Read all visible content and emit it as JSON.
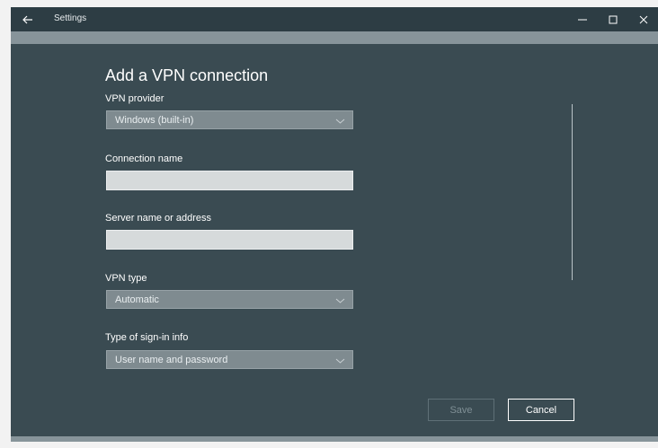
{
  "window": {
    "title": "Settings",
    "icons": {
      "back": "back-arrow-icon",
      "minimize": "minimize-icon",
      "maximize": "maximize-icon",
      "close": "close-icon"
    }
  },
  "page": {
    "heading": "Add a VPN connection"
  },
  "form": {
    "vpn_provider": {
      "label": "VPN provider",
      "value": "Windows (built-in)"
    },
    "connection_name": {
      "label": "Connection name",
      "value": ""
    },
    "server_address": {
      "label": "Server name or address",
      "value": ""
    },
    "vpn_type": {
      "label": "VPN type",
      "value": "Automatic"
    },
    "sign_in_type": {
      "label": "Type of sign-in info",
      "value": "User name and password"
    }
  },
  "actions": {
    "save": "Save",
    "cancel": "Cancel"
  },
  "colors": {
    "background": "#3a4b52",
    "titlebar": "#2d3d44",
    "dropdown": "#7f8b90",
    "textbox": "#d6dadb"
  }
}
